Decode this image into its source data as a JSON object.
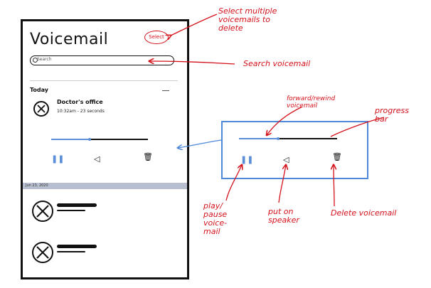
{
  "screen": {
    "title": "Voicemail",
    "select_label": "Select",
    "search_placeholder": "Search",
    "today_label": "Today",
    "date_band_label": "Jun 23, 2020",
    "voicemail": {
      "name": "Doctor's office",
      "meta": "10:32am - 23 seconds"
    },
    "icons": {
      "pause": "pause-icon",
      "speaker": "speaker-icon",
      "delete": "trash-icon",
      "avatar": "avatar-x-icon"
    }
  },
  "annotations": {
    "select": "Select multiple voicemails to delete",
    "search": "Search voicemail",
    "forward_rewind": "forward/rewind voicemail",
    "progress": "progress bar",
    "play_pause": "play/ pause voice- mail",
    "speaker": "put on speaker",
    "delete": "Delete voicemail"
  },
  "colors": {
    "annotation_red": "#d4121b",
    "accent_blue": "#5b8ed6",
    "date_band": "#b7bfd0"
  },
  "progress": {
    "fraction": 0.4
  }
}
